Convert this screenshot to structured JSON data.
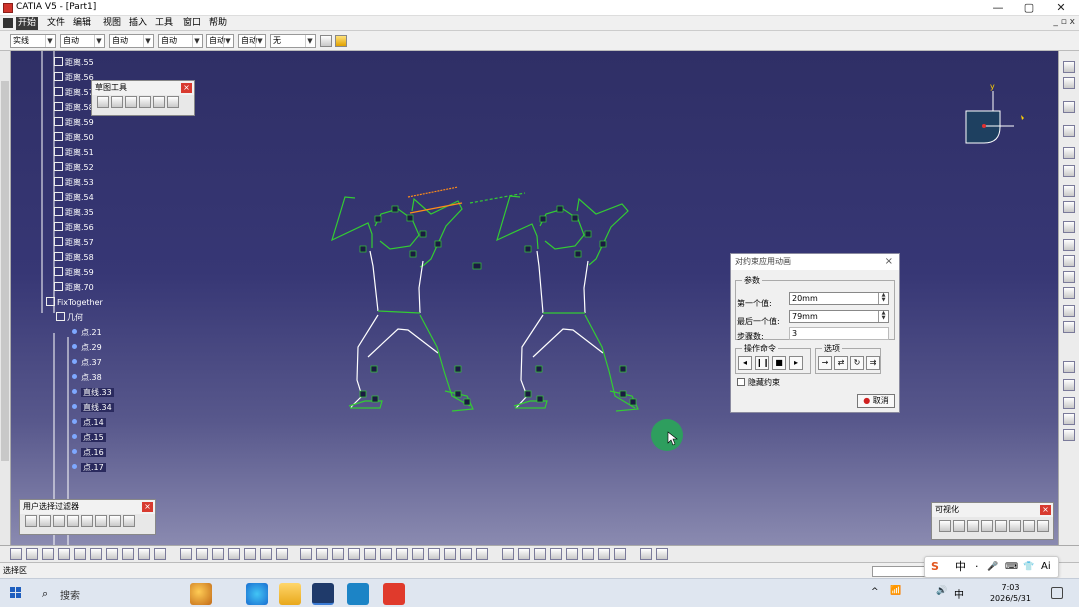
{
  "window": {
    "title": "CATIA V5 - [Part1]",
    "controls": {
      "minimize": "—",
      "maximize": "▢",
      "close": "✕"
    }
  },
  "menubar": {
    "items": [
      "开始",
      "文件",
      "编辑",
      "视图",
      "插入",
      "工具",
      "窗口",
      "帮助"
    ],
    "active_index": 0,
    "mdi_controls": "_ ▫ x"
  },
  "combobar": {
    "combos": [
      "实线",
      "自动",
      "自动",
      "自动",
      "自动",
      "自动",
      "无"
    ]
  },
  "tree": {
    "items": [
      {
        "label": "距离.55",
        "kind": "constraint"
      },
      {
        "label": "距离.56",
        "kind": "constraint"
      },
      {
        "label": "距离.57",
        "kind": "constraint"
      },
      {
        "label": "距离.58",
        "kind": "constraint"
      },
      {
        "label": "距离.59",
        "kind": "constraint"
      },
      {
        "label": "距离.50",
        "kind": "constraint"
      },
      {
        "label": "距离.51",
        "kind": "constraint"
      },
      {
        "label": "距离.52",
        "kind": "constraint"
      },
      {
        "label": "距离.53",
        "kind": "constraint"
      },
      {
        "label": "距离.54",
        "kind": "constraint"
      },
      {
        "label": "距离.35",
        "kind": "constraint"
      },
      {
        "label": "距离.56",
        "kind": "constraint"
      },
      {
        "label": "距离.57",
        "kind": "constraint"
      },
      {
        "label": "距离.58",
        "kind": "constraint"
      },
      {
        "label": "距离.59",
        "kind": "constraint"
      },
      {
        "label": "距离.70",
        "kind": "constraint"
      },
      {
        "label": "FixTogether",
        "kind": "fix"
      },
      {
        "label": "几何",
        "kind": "geometry"
      },
      {
        "label": "点.21",
        "kind": "point"
      },
      {
        "label": "点.29",
        "kind": "point"
      },
      {
        "label": "点.37",
        "kind": "point"
      },
      {
        "label": "点.38",
        "kind": "point"
      },
      {
        "label": "直线.33",
        "kind": "line"
      },
      {
        "label": "直线.34",
        "kind": "line"
      },
      {
        "label": "点.14",
        "kind": "point"
      },
      {
        "label": "点.15",
        "kind": "point"
      },
      {
        "label": "点.16",
        "kind": "point"
      },
      {
        "label": "点.17",
        "kind": "point"
      }
    ]
  },
  "sketch_tools_palette": {
    "title": "草图工具",
    "close": "×"
  },
  "user_selection_filter": {
    "title": "用户选择过滤器",
    "close": "×"
  },
  "visualization_palette": {
    "title": "可视化",
    "close": "×"
  },
  "dialog": {
    "title": "对约束应用动画",
    "close": "×",
    "params_group": "参数",
    "first_value_label": "第一个值:",
    "first_value": "20mm",
    "last_value_label": "最后一个值:",
    "last_value": "79mm",
    "steps_label": "步骤数:",
    "steps_value": "3",
    "actions_group": "操作命令",
    "options_group": "选项",
    "action_buttons": [
      "◂",
      "❙❙",
      "■",
      "▸"
    ],
    "option_buttons": [
      "→",
      "⇄",
      "↻",
      "⇉"
    ],
    "hide_constraints_label": "隐藏约束",
    "cancel_label": "取消"
  },
  "compass": {
    "axis_label": "y"
  },
  "statusbar": {
    "text": "选择区"
  },
  "taskbar": {
    "search_label": "搜索",
    "time": "7:03",
    "date": "2026/5/31",
    "tray_icons": [
      "^",
      "📶",
      "🔊",
      "中"
    ]
  },
  "ime": {
    "chars": [
      "S",
      "中",
      "·",
      "🎤",
      "⌨",
      "👕",
      "Ai"
    ]
  },
  "colors": {
    "viewport_top": "#2f2f66",
    "sketch_green": "#33cc33",
    "sketch_white": "#ffffff",
    "dimension_orange": "#ff8c1a",
    "cursor_green": "#2e9e5e"
  },
  "icons": {
    "tree_constraint": "constraint-icon",
    "tree_fix": "fix-together-icon",
    "tree_geometry": "geometry-icon",
    "compass": "compass-icon",
    "cursor": "cursor-pointer-icon"
  }
}
